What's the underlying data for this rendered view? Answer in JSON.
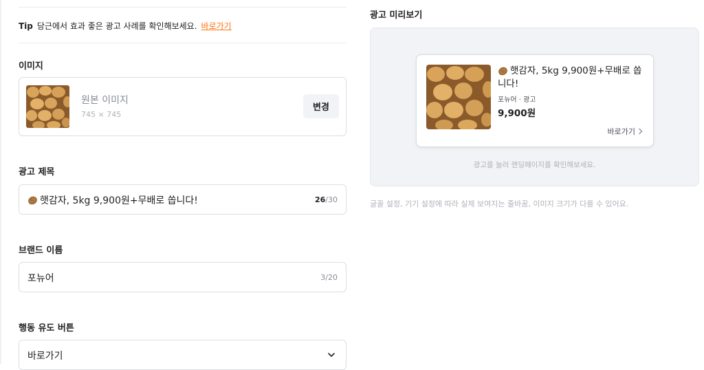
{
  "tip": {
    "label": "Tip",
    "text": "당근에서 효과 좋은 광고 사례를 확인해보세요.",
    "link": "바로가기"
  },
  "image_section": {
    "label": "이미지",
    "name": "원본 이미지",
    "size": "745 × 745",
    "change_button": "변경"
  },
  "ad_title": {
    "label": "광고 제목",
    "value": "햇감자, 5kg 9,900원+무배로 쏩니다!",
    "count_current": "26",
    "count_max": "/30"
  },
  "brand": {
    "label": "브랜드 이름",
    "value": "포뉴어",
    "count": "3/20"
  },
  "cta": {
    "label": "행동 유도 버튼",
    "selected": "바로가기",
    "icon": "chevron-down-icon"
  },
  "preview": {
    "title": "광고 미리보기",
    "ad_title": "햇감자, 5kg 9,900원+무배로 쏩니다!",
    "brand_line": "포뉴어 · 광고",
    "price": "9,900원",
    "cta": "바로가기",
    "panel_note": "광고를 눌러 랜딩페이지를 확인해보세요.",
    "bottom_note": "글꼴 설정, 기기 설정에 따라 실제 보여지는 줄바꿈, 이미지 크기가 다를 수 있어요."
  },
  "colors": {
    "accent": "#ff6f0f",
    "text": "#212124",
    "muted": "#868b94",
    "border": "#dcdee3",
    "panel_bg": "#f2f3f6"
  }
}
